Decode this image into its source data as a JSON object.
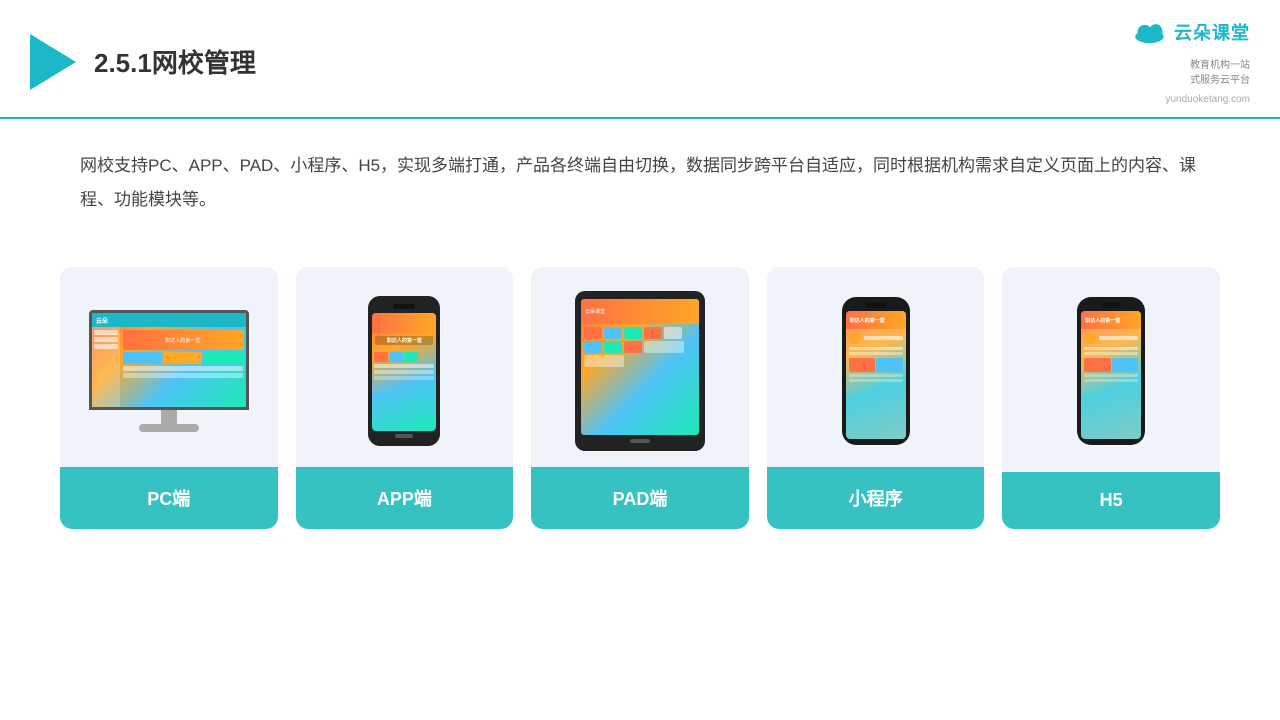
{
  "header": {
    "title": "2.5.1网校管理",
    "brand_name": "云朵课堂",
    "brand_url": "yunduoketang.com",
    "brand_tagline": "教育机构一站\n式服务云平台"
  },
  "description": {
    "text": "网校支持PC、APP、PAD、小程序、H5，实现多端打通，产品各终端自由切换，数据同步跨平台自适应，同时根据机构需求自定义页面上的内容、课程、功能模块等。"
  },
  "cards": [
    {
      "id": "pc",
      "label": "PC端"
    },
    {
      "id": "app",
      "label": "APP端"
    },
    {
      "id": "pad",
      "label": "PAD端"
    },
    {
      "id": "miniprogram",
      "label": "小程序"
    },
    {
      "id": "h5",
      "label": "H5"
    }
  ],
  "colors": {
    "accent": "#36c2c2",
    "header_line": "#1db8c8",
    "card_bg": "#f0f4fa",
    "title": "#333",
    "text": "#444"
  }
}
